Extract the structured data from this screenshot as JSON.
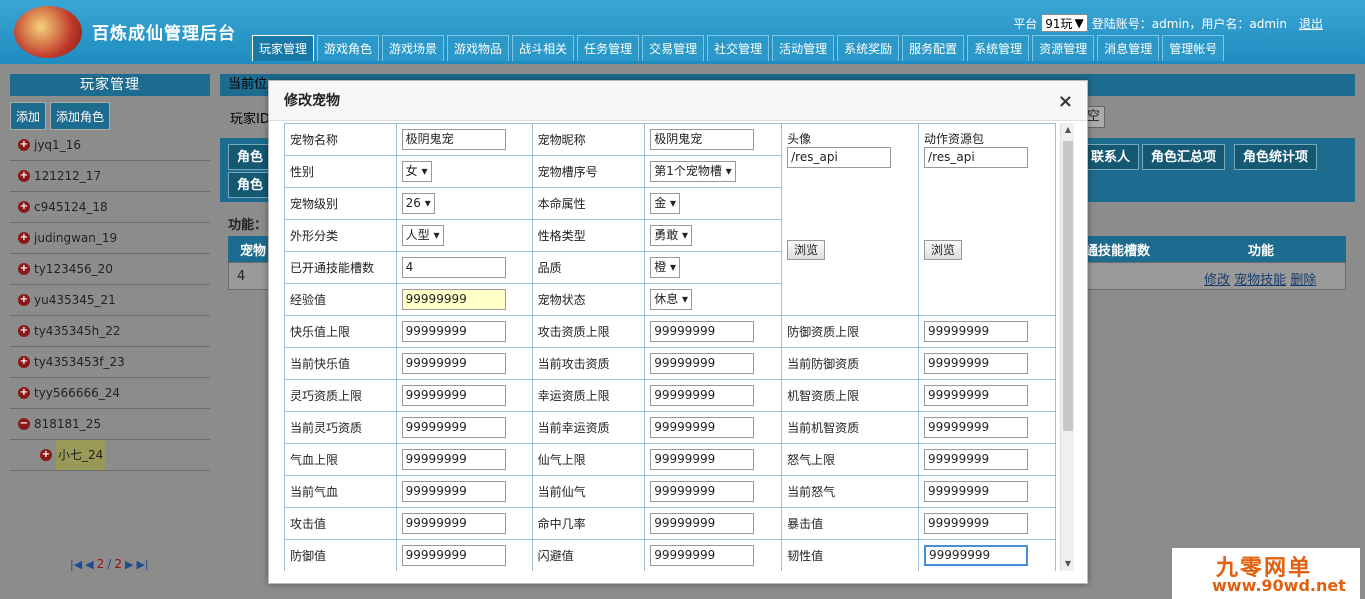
{
  "app": {
    "title": "百炼成仙管理后台"
  },
  "topinfo": {
    "platform_label": "平台",
    "platform_value": "91玩",
    "login_label": "登陆账号：admin，用户名：admin",
    "logout": "退出"
  },
  "nav": [
    "玩家管理",
    "游戏角色",
    "游戏场景",
    "游戏物品",
    "战斗相关",
    "任务管理",
    "交易管理",
    "社交管理",
    "活动管理",
    "系统奖励",
    "服务配置",
    "系统管理",
    "资源管理",
    "消息管理",
    "管理帐号"
  ],
  "left": {
    "title": "玩家管理",
    "btn_add": "添加",
    "btn_add_role": "添加角色",
    "items": [
      "jyq1_16",
      "121212_17",
      "c945124_18",
      "judingwan_19",
      "ty123456_20",
      "yu435345_21",
      "ty435345h_22",
      "ty4353453f_23",
      "tyy566666_24",
      "818181_25"
    ],
    "sub_item": "小七_24",
    "pager": {
      "current": "2",
      "sep": "/",
      "total": "2"
    }
  },
  "right": {
    "crumb": "当前位",
    "player_label": "玩家ID",
    "empty_btn": "空",
    "tabs": [
      "角色",
      "角色",
      "联系人",
      "角色汇总项",
      "角色统计项"
    ],
    "func_label": "功能：",
    "col1": "宠物",
    "col_skill_slots": "通技能槽数",
    "col_func": "功能",
    "row_id": "4",
    "row_actions": [
      "修改",
      "宠物技能",
      "删除"
    ]
  },
  "modal": {
    "title": "修改宠物",
    "close": "×",
    "name_label": "宠物名称",
    "name": "极阴鬼宠",
    "nick_label": "宠物昵称",
    "nick": "极阴鬼宠",
    "avatar_label": "头像",
    "avatar": "/res_api",
    "anim_label": "动作资源包",
    "anim": "/res_api",
    "browse": "浏览",
    "sex_label": "性别",
    "sex": "女",
    "slot_label": "宠物槽序号",
    "slot": "第1个宠物槽",
    "level_label": "宠物级别",
    "level": "26",
    "element_label": "本命属性",
    "element": "金",
    "shape_label": "外形分类",
    "shape": "人型",
    "char_label": "性格类型",
    "char": "勇敢",
    "skillslots_label": "已开通技能槽数",
    "skillslots": "4",
    "quality_label": "品质",
    "quality": "橙",
    "exp_label": "经验值",
    "exp": "99999999",
    "state_label": "宠物状态",
    "state": "休息",
    "rows": [
      [
        "快乐值上限",
        "99999999",
        "攻击资质上限",
        "99999999",
        "防御资质上限",
        "99999999"
      ],
      [
        "当前快乐值",
        "99999999",
        "当前攻击资质",
        "99999999",
        "当前防御资质",
        "99999999"
      ],
      [
        "灵巧资质上限",
        "99999999",
        "幸运资质上限",
        "99999999",
        "机智资质上限",
        "99999999"
      ],
      [
        "当前灵巧资质",
        "99999999",
        "当前幸运资质",
        "99999999",
        "当前机智资质",
        "99999999"
      ],
      [
        "气血上限",
        "99999999",
        "仙气上限",
        "99999999",
        "怒气上限",
        "99999999"
      ],
      [
        "当前气血",
        "99999999",
        "当前仙气",
        "99999999",
        "当前怒气",
        "99999999"
      ],
      [
        "攻击值",
        "99999999",
        "命中几率",
        "99999999",
        "暴击值",
        "99999999"
      ],
      [
        "防御值",
        "99999999",
        "闪避值",
        "99999999",
        "韧性值",
        "99999999"
      ]
    ]
  },
  "watermark": {
    "line1": "九零网单",
    "line2": "www.90wd.net"
  }
}
